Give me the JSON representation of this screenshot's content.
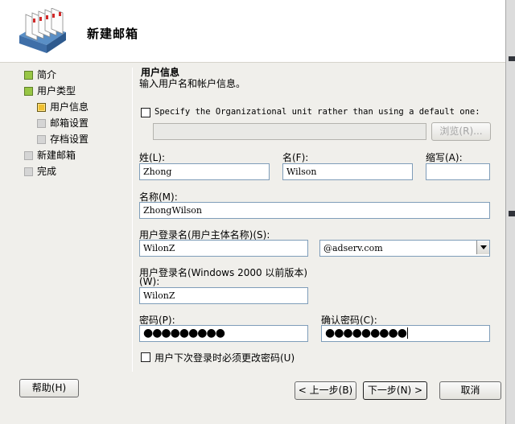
{
  "header": {
    "title": "新建邮箱"
  },
  "nav": {
    "items": [
      {
        "label": "简介",
        "state": "done"
      },
      {
        "label": "用户类型",
        "state": "done"
      },
      {
        "label": "用户信息",
        "state": "current"
      },
      {
        "label": "邮箱设置",
        "state": "pending"
      },
      {
        "label": "存档设置",
        "state": "pending"
      },
      {
        "label": "新建邮箱",
        "state": "pending"
      },
      {
        "label": "完成",
        "state": "pending"
      }
    ]
  },
  "section": {
    "title": "用户信息",
    "description": "输入用户名和帐户信息。"
  },
  "ou": {
    "checkbox_label": "Specify the Organizational unit rather than using a default one:",
    "path_value": "",
    "browse_label": "浏览(R)..."
  },
  "fields": {
    "last_name_label": "姓(L):",
    "last_name_value": "Zhong",
    "first_name_label": "名(F):",
    "first_name_value": "Wilson",
    "initials_label": "缩写(A):",
    "initials_value": "",
    "display_name_label": "名称(M):",
    "display_name_value": "ZhongWilson",
    "upn_label": "用户登录名(用户主体名称)(S):",
    "upn_value": "WilonZ",
    "domain_value": "@adserv.com",
    "sam_label_line1": "用户登录名(Windows 2000 以前版本)",
    "sam_label_line2": "(W):",
    "sam_value": "WilonZ",
    "password_label": "密码(P):",
    "password_value": "●●●●●●●●●",
    "confirm_label": "确认密码(C):",
    "confirm_value": "●●●●●●●●●",
    "must_change_label": "用户下次登录时必须更改密码(U)"
  },
  "buttons": {
    "help": "帮助(H)",
    "back": "< 上一步(B)",
    "next": "下一步(N) >",
    "cancel": "取消"
  }
}
